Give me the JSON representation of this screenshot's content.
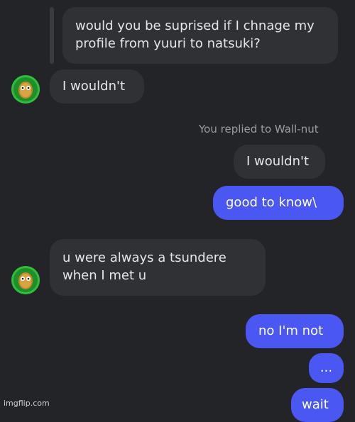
{
  "chat": {
    "contact_name": "Wall-nut",
    "messages": [
      {
        "sender": "me",
        "style": "reply-quote",
        "text_line1": "would you be suprised if I chnage my",
        "text_line2": "profile from yuuri to natsuki?"
      },
      {
        "sender": "them",
        "text": "I wouldn't"
      },
      {
        "sender": "me",
        "style": "replied-quote",
        "text": "I wouldn't"
      },
      {
        "sender": "me",
        "text": "good to know\\"
      },
      {
        "sender": "them",
        "text_line1": "u were always a tsundere",
        "text_line2": "when I met u"
      },
      {
        "sender": "me",
        "text": "no I'm not"
      },
      {
        "sender": "me",
        "text": "..."
      },
      {
        "sender": "me",
        "text": "wait"
      }
    ],
    "reply_notice": "You replied to Wall-nut"
  },
  "watermark": "imgflip.com",
  "colors": {
    "background": "#232428",
    "incoming": "#303135",
    "outgoing": "#4a57f2",
    "avatar_ring": "#2fbf3a"
  },
  "icons": {
    "avatar": "wall-nut-avatar-icon"
  }
}
